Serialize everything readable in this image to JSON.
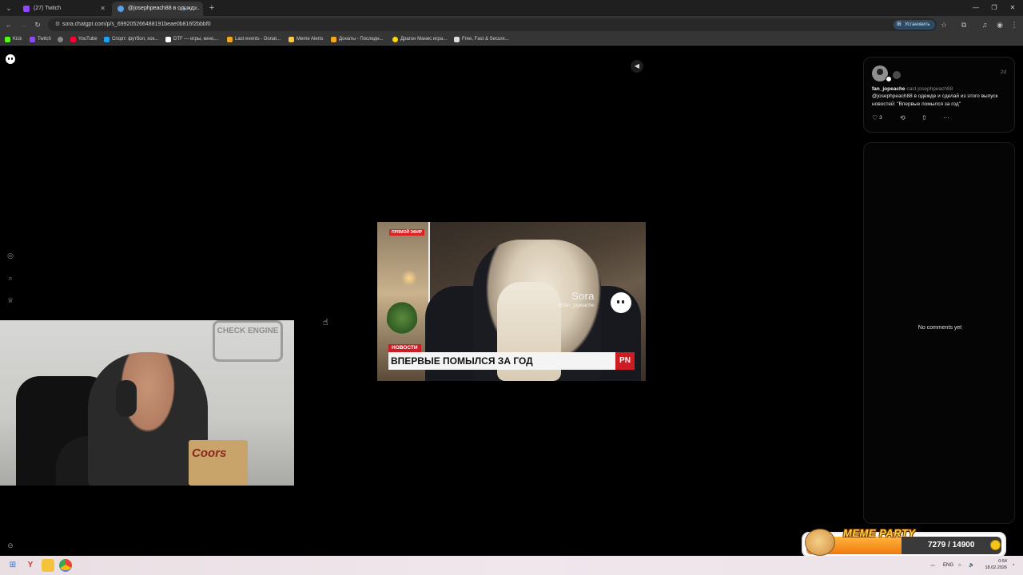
{
  "browser": {
    "tabs": [
      {
        "title": "(27) Twitch",
        "favicon_color": "#9146ff",
        "active": false
      },
      {
        "title": "@josephpeach88 в одежд…",
        "favicon_color": "#5aa0e8",
        "active": true
      }
    ],
    "new_tab_icon": "plus-icon",
    "url": "sora.chatgpt.com/p/s_699205266488191beae0b816f2bbbf0",
    "install_label": "Установить",
    "bookmarks": [
      {
        "label": "Kick",
        "color": "#53fc18"
      },
      {
        "label": "Twitch",
        "color": "#9146ff"
      },
      {
        "label": "",
        "color": "#888888"
      },
      {
        "label": "YouTube",
        "color": "#ff0033"
      },
      {
        "label": "Спорт: футбол, хок...",
        "color": "#1da1f2"
      },
      {
        "label": "DTF — игры, кино,...",
        "color": "#ffffff"
      },
      {
        "label": "Last events - Donat...",
        "color": "#f5a623"
      },
      {
        "label": "Meme Alerts",
        "color": "#f7c948"
      },
      {
        "label": "Донаты - Последн...",
        "color": "#f5a623"
      },
      {
        "label": "Драгон Манис игра...",
        "color": "#ffd700"
      },
      {
        "label": "Free, Fast & Secure...",
        "color": "#dddddd"
      }
    ]
  },
  "video": {
    "live_badge": "ПРЯМОЙ ЭФИР",
    "watermark_name": "Sora",
    "watermark_handle": "@fan_jopeache",
    "news_tag": "НОВОСТИ",
    "headline": "ВПЕРВЫЕ ПОМЫЛСЯ ЗА ГОД",
    "channel_logo": "PN"
  },
  "webcam": {
    "wall_sign": "CHECK ENGINE",
    "box_text": "Coors"
  },
  "post": {
    "time_ago": "2d",
    "author": "fan_jopeache",
    "cast_text": "cast josephpeach88",
    "text": "@josephpeach88 в одежде и сделай из этого выпуск новостей: \"Впервые помылся за год\"",
    "likes": "3"
  },
  "comments": {
    "empty_text": "No comments yet"
  },
  "meme_party": {
    "title": "MEME PARTY",
    "current": 7279,
    "goal": 14900,
    "display": "7279 / 14900",
    "progress_fraction": 0.4885
  },
  "taskbar": {
    "lang": "ENG",
    "time": "0:54",
    "date": "18.02.2026"
  }
}
